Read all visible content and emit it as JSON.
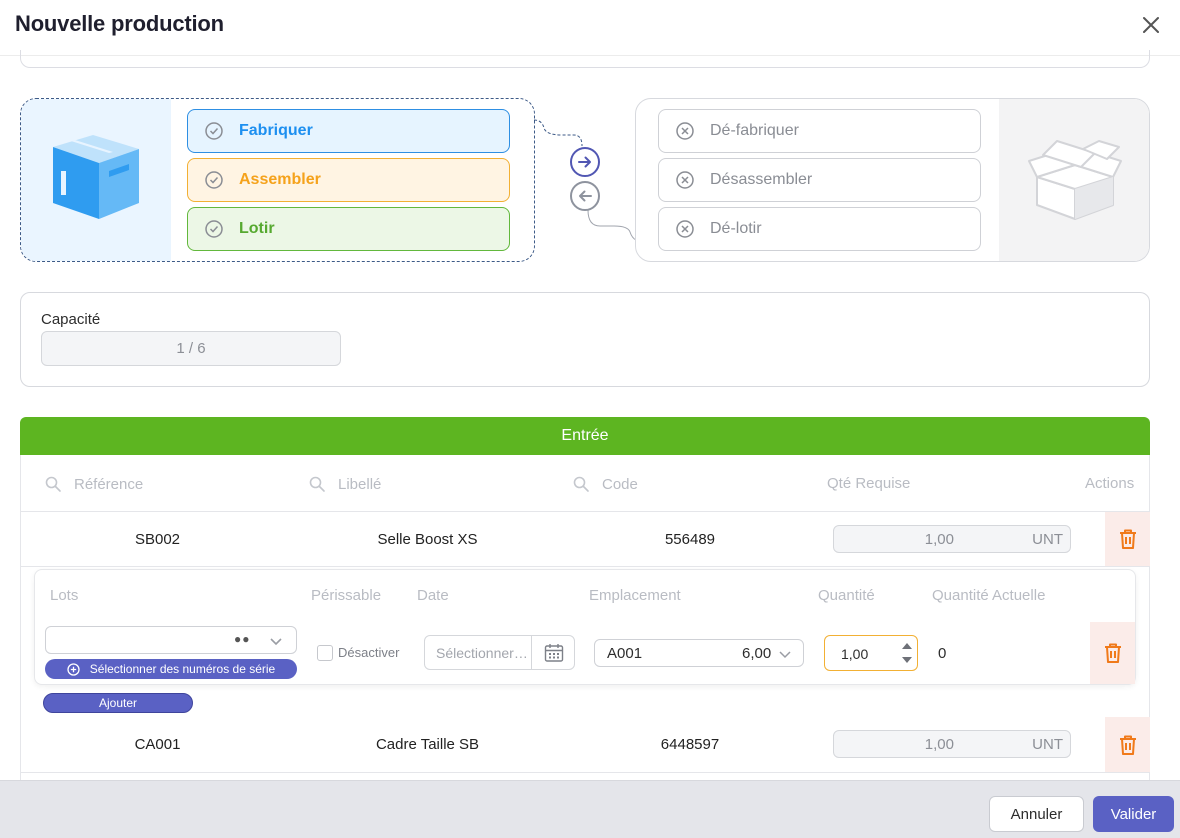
{
  "dialog": {
    "title": "Nouvelle production"
  },
  "modes": {
    "production": [
      {
        "label": "Fabriquer",
        "color": "#1d8ff0"
      },
      {
        "label": "Assembler",
        "color": "#f5a21b"
      },
      {
        "label": "Lotir",
        "color": "#56a930"
      }
    ],
    "reverse": [
      {
        "label": "Dé-fabriquer"
      },
      {
        "label": "Désassembler"
      },
      {
        "label": "Dé-lotir"
      }
    ],
    "icons": {
      "production": "box-closed-icon",
      "reverse": "box-open-icon",
      "forward": "arrow-right-icon",
      "backward": "arrow-left-icon"
    }
  },
  "capacity": {
    "label": "Capacité",
    "value": "1 / 6"
  },
  "entry": {
    "title": "Entrée",
    "header_color": "#5db521",
    "columns": [
      "Référence",
      "Libellé",
      "Code",
      "Qté Requise",
      "Actions"
    ],
    "rows": [
      {
        "ref": "SB002",
        "label": "Selle Boost XS",
        "code": "556489",
        "qty": "1,00",
        "unit": "UNT"
      },
      {
        "ref": "CA001",
        "label": "Cadre Taille SB",
        "code": "6448597",
        "qty": "1,00",
        "unit": "UNT"
      }
    ]
  },
  "lots": {
    "columns": [
      "Lots",
      "Périssable",
      "Date",
      "Emplacement",
      "Quantité",
      "Quantité Actuelle"
    ],
    "serial_button": "Sélectionner des numéros de série",
    "disable_label": "Désactiver",
    "date_placeholder": "Sélectionner une date",
    "location": "A001",
    "location_qty": "6,00",
    "quantity": "1,00",
    "current_quantity": "0",
    "add_button": "Ajouter"
  },
  "footer": {
    "cancel": "Annuler",
    "validate": "Valider",
    "accent": "#5a61c4"
  }
}
